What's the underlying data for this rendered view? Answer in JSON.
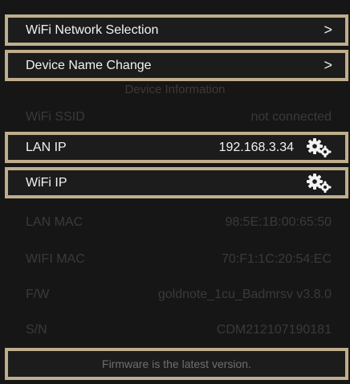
{
  "menu": {
    "wifi_selection": "WiFi Network Selection",
    "device_name_change": "Device Name Change",
    "chevron": ">"
  },
  "section_title": "Device Information",
  "info": {
    "wifi_ssid": {
      "label": "WiFi SSID",
      "value": "not connected"
    },
    "lan_ip": {
      "label": "LAN IP",
      "value": "192.168.3.34"
    },
    "wifi_ip": {
      "label": "WiFi IP",
      "value": ""
    },
    "lan_mac": {
      "label": "LAN MAC",
      "value": "98:5E:1B:00:65:50"
    },
    "wifi_mac": {
      "label": "WIFI MAC",
      "value": "70:F1:1C:20:54:EC"
    },
    "fw": {
      "label": "F/W",
      "value": "goldnote_1cu_Badmrsv v3.8.0"
    },
    "sn": {
      "label": "S/N",
      "value": "CDM212107190181"
    }
  },
  "footer_text": "Firmware is the latest version.",
  "icons": {
    "settings": "gears-icon",
    "next": "chevron-right-icon"
  },
  "colors": {
    "frame": "#bfae8c",
    "background": "#161616",
    "text": "#f2f2f2",
    "dim_text": "#3a3a3a"
  }
}
